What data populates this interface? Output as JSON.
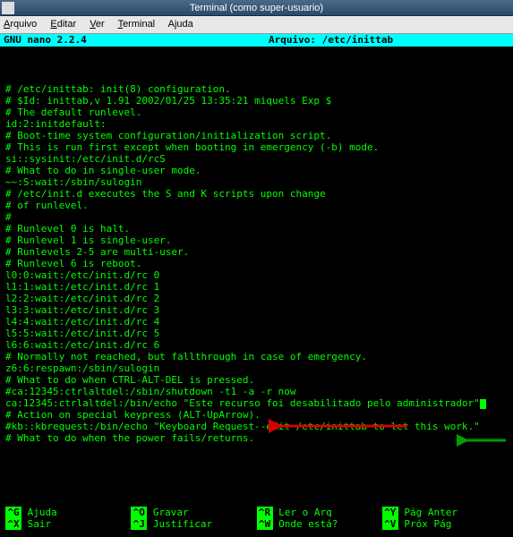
{
  "window": {
    "title": "Terminal (como super-usuario)"
  },
  "menubar": {
    "items": [
      "Arquivo",
      "Editar",
      "Ver",
      "Terminal",
      "Ajuda"
    ]
  },
  "nano": {
    "app": "GNU nano 2.2.4",
    "file_label": "Arquivo: /etc/inittab"
  },
  "content": [
    "# /etc/inittab: init(8) configuration.",
    "# $Id: inittab,v 1.91 2002/01/25 13:35:21 miquels Exp $",
    "",
    "# The default runlevel.",
    "id:2:initdefault:",
    "",
    "# Boot-time system configuration/initialization script.",
    "# This is run first except when booting in emergency (-b) mode.",
    "si::sysinit:/etc/init.d/rcS",
    "",
    "# What to do in single-user mode.",
    "~~:S:wait:/sbin/sulogin",
    "",
    "# /etc/init.d executes the S and K scripts upon change",
    "# of runlevel.",
    "#",
    "# Runlevel 0 is halt.",
    "# Runlevel 1 is single-user.",
    "# Runlevels 2-5 are multi-user.",
    "# Runlevel 6 is reboot.",
    "",
    "l0:0:wait:/etc/init.d/rc 0",
    "l1:1:wait:/etc/init.d/rc 1",
    "l2:2:wait:/etc/init.d/rc 2",
    "l3:3:wait:/etc/init.d/rc 3",
    "l4:4:wait:/etc/init.d/rc 4",
    "l5:5:wait:/etc/init.d/rc 5",
    "l6:6:wait:/etc/init.d/rc 6",
    "# Normally not reached, but fallthrough in case of emergency.",
    "z6:6:respawn:/sbin/sulogin",
    "",
    "# What to do when CTRL-ALT-DEL is pressed.",
    "#ca:12345:ctrlaltdel:/sbin/shutdown -t1 -a -r now",
    "ca:12345:ctrlaltdel:/bin/echo \"Este recurso foi desabilitado pelo administrador\"",
    "",
    "# Action on special keypress (ALT-UpArrow).",
    "#kb::kbrequest:/bin/echo \"Keyboard Request--edit /etc/inittab to let this work.\"",
    "",
    "# What to do when the power fails/returns."
  ],
  "shortcuts": [
    {
      "key": "^G",
      "label": "Ajuda"
    },
    {
      "key": "^X",
      "label": "Sair"
    },
    {
      "key": "^O",
      "label": "Gravar"
    },
    {
      "key": "^J",
      "label": "Justificar"
    },
    {
      "key": "^R",
      "label": "Ler o Arq"
    },
    {
      "key": "^W",
      "label": "Onde está?"
    },
    {
      "key": "^Y",
      "label": "Pág Anter"
    },
    {
      "key": "^V",
      "label": "Próx Pág"
    }
  ],
  "arrows": {
    "red": {
      "color": "#d40000"
    },
    "green": {
      "color": "#009e00"
    }
  }
}
